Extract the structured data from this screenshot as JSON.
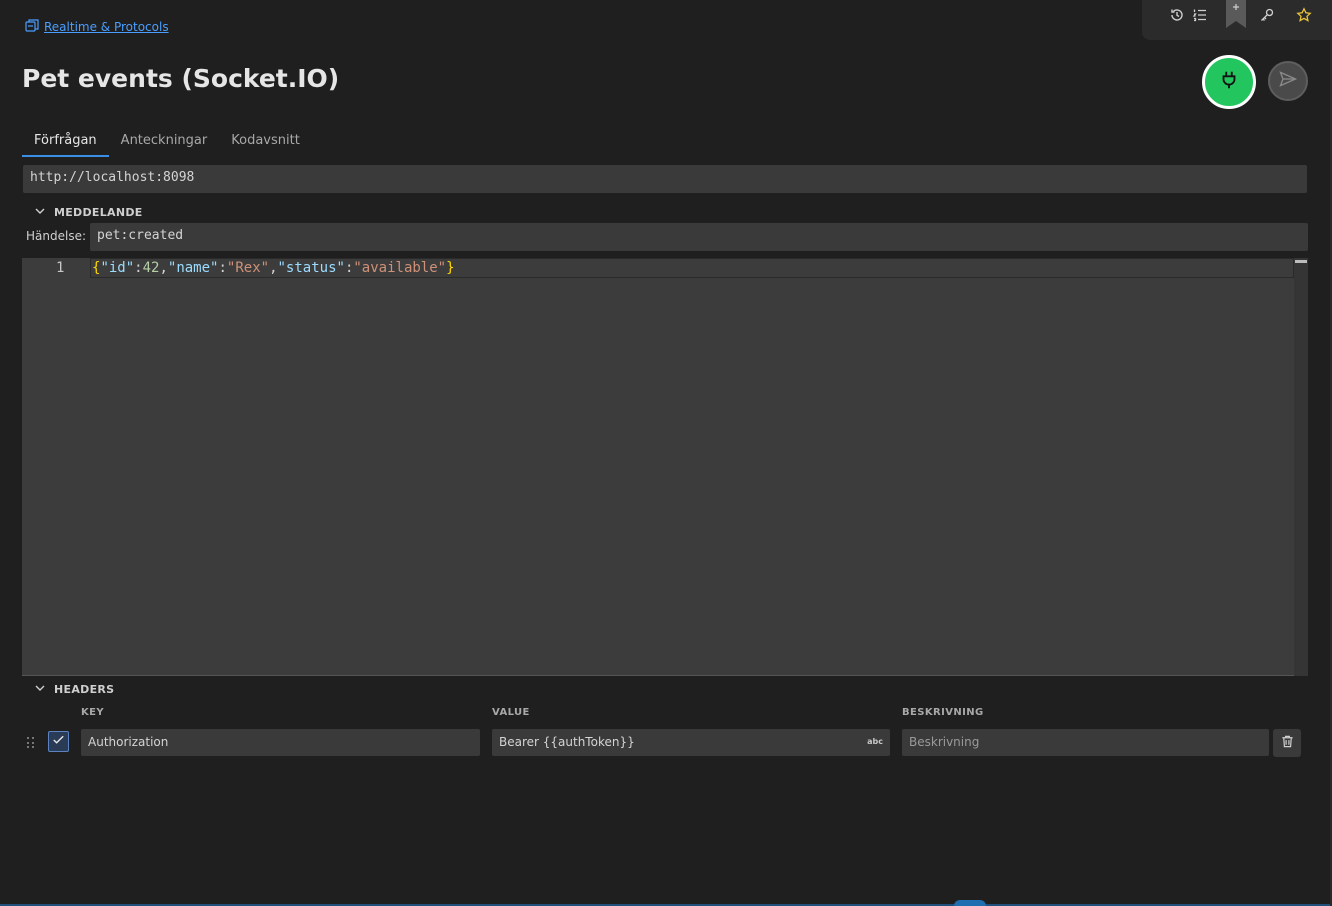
{
  "breadcrumb": {
    "label": "Realtime & Protocols"
  },
  "page": {
    "title": "Pet events (Socket.IO)"
  },
  "tabs": [
    {
      "label": "Förfrågan",
      "active": true
    },
    {
      "label": "Anteckningar",
      "active": false
    },
    {
      "label": "Kodavsnitt",
      "active": false
    }
  ],
  "url": {
    "value": "http://localhost:8098"
  },
  "message": {
    "section_label": "MEDDELANDE",
    "event_label": "Händelse:",
    "event_value": "pet:created",
    "line_number": "1",
    "code": {
      "brace_open": "{",
      "k1": "\"id\"",
      "c1": ":",
      "v1": "42",
      "s1": ",",
      "k2": "\"name\"",
      "c2": ":",
      "v2": "\"Rex\"",
      "s2": ",",
      "k3": "\"status\"",
      "c3": ":",
      "v3": "\"available\"",
      "brace_close": "}"
    }
  },
  "headers": {
    "section_label": "HEADERS",
    "columns": {
      "key": "KEY",
      "value": "VALUE",
      "description": "BESKRIVNING"
    },
    "rows": [
      {
        "enabled": true,
        "key": "Authorization",
        "value": "Bearer {{authToken}}",
        "value_tag": "abc",
        "description_placeholder": "Beskrivning"
      }
    ]
  },
  "colors": {
    "accent": "#3a8ee6",
    "connect": "#22c55e",
    "link": "#4a9eff"
  },
  "icons": {
    "toolbar": [
      "history-icon",
      "list-icon",
      "bookmark-icon",
      "key-icon",
      "star-icon"
    ],
    "connect": "plug-icon",
    "send": "send-icon",
    "delete": "trash-icon"
  }
}
